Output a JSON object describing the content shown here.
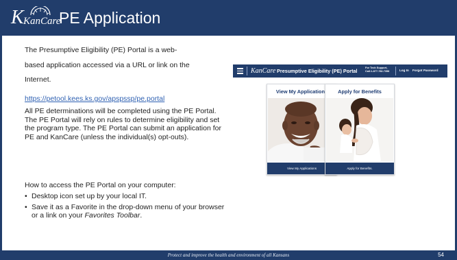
{
  "header": {
    "logo_text": "KanCare",
    "title": "PE Application"
  },
  "content": {
    "intro_line1": "The Presumptive Eligibility (PE) Portal is a web-",
    "intro_line2": "based application accessed via a URL or link on the",
    "intro_line3": "Internet.",
    "portal_url": "https://petool.kees.ks.gov/apspssp/pe.portal",
    "paragraph": "All PE determinations will be completed using the PE Portal. The PE Portal will rely on rules to determine eligibility and set the program type. The PE Portal can submit an application for PE and KanCare (unless the individual(s) opt-outs).",
    "how_to_heading": "How to access the PE Portal on your computer:",
    "bullets": [
      {
        "text": "Desktop icon set up by your local IT."
      },
      {
        "text_before": "Save it as a Favorite in the drop-down menu of your browser or a link on your ",
        "emphasis": "Favorites Toolbar",
        "text_after": "."
      }
    ]
  },
  "portal": {
    "logo_text": "KanCare",
    "title": "Presumptive Eligibility (PE) Portal",
    "support_line1": "For Tech Support,",
    "support_line2": "Call:1-877-782-7358",
    "login_label": "Log In",
    "forgot_label": "Forgot Password",
    "cards": [
      {
        "title": "View My Applications",
        "button_label": "View My Applications",
        "image_icon": "smiling-man-photo"
      },
      {
        "title": "Apply for Benefits",
        "button_label": "Apply for Benefits.",
        "image_icon": "mother-and-child-photo"
      }
    ]
  },
  "footer": {
    "tagline": "Protect and improve the health and environment of all Kansans",
    "page_number": "54"
  },
  "colors": {
    "brand_navy": "#213d6b",
    "link_blue": "#2f61b2",
    "card_title": "#1f3d73"
  }
}
